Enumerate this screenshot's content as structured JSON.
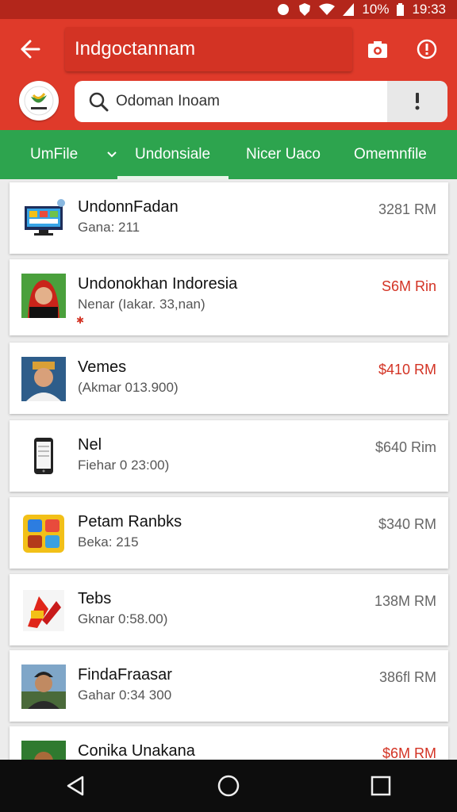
{
  "status_bar": {
    "battery": "10%",
    "time": "19:33"
  },
  "app_bar": {
    "title": "Indgoctannam",
    "search_value": "Odoman Inoam"
  },
  "tabs": [
    {
      "label": "UmFile"
    },
    {
      "label": "Undonsiale"
    },
    {
      "label": "Nicer Uaco"
    },
    {
      "label": "Omemnfile"
    }
  ],
  "items": [
    {
      "title": "UndonnFadan",
      "subtitle": "Gana: 211",
      "price": "3281 RM",
      "price_color": "#666666",
      "icon": "monitor-icon"
    },
    {
      "title": "Undonokhan Indoresia",
      "subtitle": "Nenar (Iakar. 33,nan)",
      "price": "S6M Rin",
      "price_color": "#d33324",
      "icon": "avatar-red-hood-icon"
    },
    {
      "title": "Vemes",
      "subtitle": "(Akmar 013.900)",
      "price": "$410 RM",
      "price_color": "#d33324",
      "icon": "avatar-man-icon"
    },
    {
      "title": "Nel",
      "subtitle": "Fiehar 0 23:00)",
      "price": "$640 Rim",
      "price_color": "#666666",
      "icon": "phone-icon"
    },
    {
      "title": "Petam Ranbks",
      "subtitle": "Beka: 215",
      "price": "$340 RM",
      "price_color": "#666666",
      "icon": "apps-grid-icon"
    },
    {
      "title": "Tebs",
      "subtitle": "Gknar 0:58.00)",
      "price": "138M RM",
      "price_color": "#666666",
      "icon": "game-icon"
    },
    {
      "title": "FindaFraasar",
      "subtitle": "Gahar 0:34 300",
      "price": "386fl RM",
      "price_color": "#666666",
      "icon": "avatar-man-icon"
    },
    {
      "title": "Conika Unakana",
      "subtitle": "",
      "price": "$6M RM",
      "price_color": "#d33324",
      "icon": "avatar-green-icon"
    }
  ]
}
